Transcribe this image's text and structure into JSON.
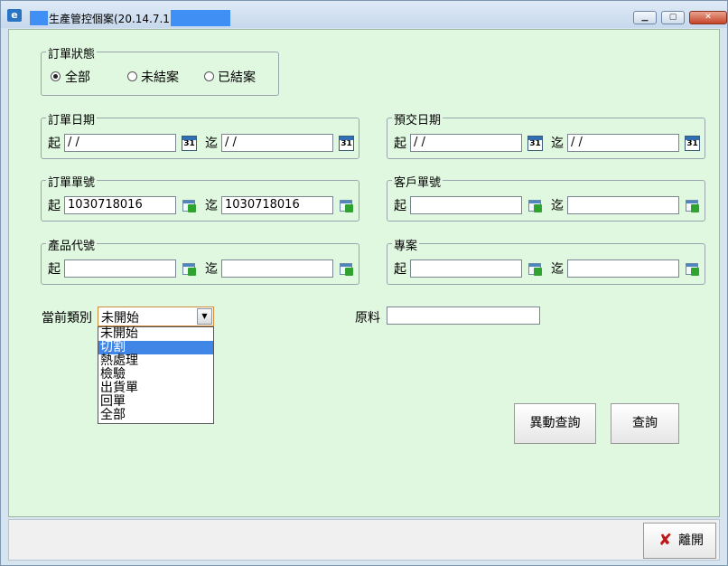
{
  "window": {
    "title": "生產管控個案(20.14.7.1)",
    "icon": "app-icon",
    "controls": [
      "minimize-icon",
      "maximize-icon",
      "close-icon"
    ]
  },
  "order_status": {
    "title": "訂單狀態",
    "options": [
      {
        "label": "全部",
        "checked": true
      },
      {
        "label": "未結案",
        "checked": false
      },
      {
        "label": "已結案",
        "checked": false
      }
    ]
  },
  "order_date": {
    "title": "訂單日期",
    "from_label": "起",
    "to_label": "迄",
    "from_value": " / /",
    "to_value": " / /"
  },
  "delivery_date": {
    "title": "預交日期",
    "from_label": "起",
    "to_label": "迄",
    "from_value": " / /",
    "to_value": " / /"
  },
  "order_number": {
    "title": "訂單單號",
    "from_label": "起",
    "to_label": "迄",
    "from_value": "1030718016",
    "to_value": "1030718016"
  },
  "customer_number": {
    "title": "客戶單號",
    "from_label": "起",
    "to_label": "迄",
    "from_value": "",
    "to_value": ""
  },
  "product_code": {
    "title": "產品代號",
    "from_label": "起",
    "to_label": "迄",
    "from_value": "",
    "to_value": ""
  },
  "project": {
    "title": "專案",
    "from_label": "起",
    "to_label": "迄",
    "from_value": "",
    "to_value": ""
  },
  "calendar_icon_text": "31",
  "current_category": {
    "label": "當前類別",
    "selected": "未開始",
    "options": [
      "未開始",
      "切割",
      "熱處理",
      "檢驗",
      "出貨單",
      "回單",
      "全部"
    ],
    "highlighted_index": 1
  },
  "material": {
    "label": "原料",
    "value": ""
  },
  "buttons": {
    "change_query": "異動查詢",
    "query": "查詢",
    "exit": "離開"
  },
  "colors": {
    "client_bg": "#e0f7e0",
    "highlight": "#3f86e6",
    "exit_icon": "#c01818"
  }
}
